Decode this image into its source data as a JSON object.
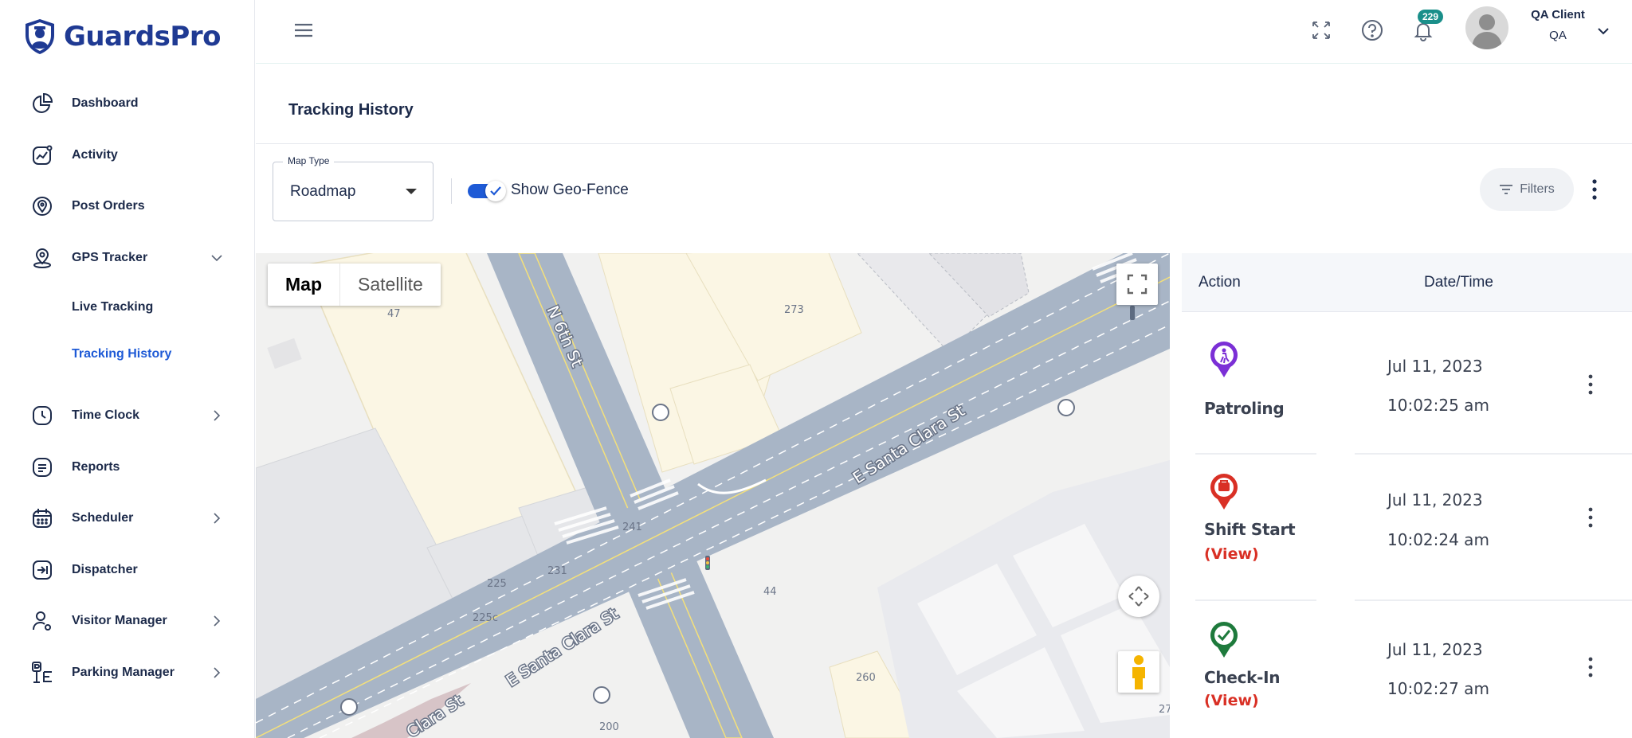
{
  "app": {
    "brand": "GuardsPro"
  },
  "sidebar": {
    "items": [
      {
        "label": "Dashboard"
      },
      {
        "label": "Activity"
      },
      {
        "label": "Post Orders"
      },
      {
        "label": "GPS Tracker"
      },
      {
        "label": "Time Clock"
      },
      {
        "label": "Reports"
      },
      {
        "label": "Scheduler"
      },
      {
        "label": "Dispatcher"
      },
      {
        "label": "Visitor Manager"
      },
      {
        "label": "Parking Manager"
      }
    ],
    "gps_sub": [
      {
        "label": "Live Tracking"
      },
      {
        "label": "Tracking History",
        "active": true
      }
    ]
  },
  "topbar": {
    "notification_count": "229",
    "user_name": "QA Client",
    "user_role": "QA"
  },
  "page": {
    "title": "Tracking History"
  },
  "toolbar": {
    "map_type_label": "Map Type",
    "map_type_value": "Roadmap",
    "geofence_label": "Show Geo-Fence",
    "geofence_on": true,
    "filters_label": "Filters"
  },
  "map": {
    "type_map": "Map",
    "type_satellite": "Satellite",
    "streets": [
      "N 6th St",
      "E Santa Clara St",
      "E Santa Clara St",
      "Clara St"
    ],
    "numbers": [
      "47",
      "273",
      "241",
      "231",
      "225",
      "225c",
      "44",
      "260",
      "200",
      "27"
    ]
  },
  "table": {
    "headers": {
      "action": "Action",
      "datetime": "Date/Time"
    },
    "rows": [
      {
        "action": "Patroling",
        "view": "",
        "date": "Jul 11, 2023",
        "time": "10:02:25 am",
        "pin_color": "#7b2fd6"
      },
      {
        "action": "Shift Start",
        "view": "(View)",
        "date": "Jul 11, 2023",
        "time": "10:02:24 am",
        "pin_color": "#d93025"
      },
      {
        "action": "Check-In",
        "view": "(View)",
        "date": "Jul 11, 2023",
        "time": "10:02:27 am",
        "pin_color": "#1e7a3c"
      }
    ]
  }
}
